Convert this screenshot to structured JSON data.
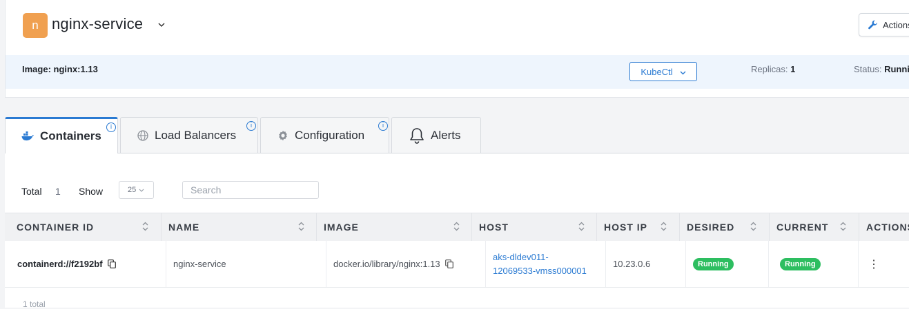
{
  "header": {
    "avatar_letter": "n",
    "service_name": "nginx-service",
    "actions_label": "Actions",
    "image_label": "Image: nginx:1.13",
    "kubectl_label": "KubeCtl",
    "replicas_label": "Replicas:",
    "replicas_value": "1",
    "status_label": "Status:",
    "status_value": "Running"
  },
  "tabs": [
    {
      "label": "Containers",
      "icon": "docker-icon",
      "active": true
    },
    {
      "label": "Load Balancers",
      "icon": "globe-icon"
    },
    {
      "label": "Configuration",
      "icon": "gear-icon"
    },
    {
      "label": "Alerts",
      "icon": "bell-icon"
    }
  ],
  "toolbar": {
    "total_label": "Total",
    "total_value": "1",
    "show_label": "Show",
    "page_size": "25",
    "search_placeholder": "Search"
  },
  "table": {
    "columns": [
      "CONTAINER ID",
      "NAME",
      "IMAGE",
      "HOST",
      "HOST IP",
      "DESIRED",
      "CURRENT",
      "ACTIONS"
    ],
    "rows": [
      {
        "container_id": "containerd://f2192bf",
        "name": "nginx-service",
        "image": "docker.io/library/nginx:1.13",
        "host_line1": "aks-dldev011-",
        "host_line2": "12069533-vmss000001",
        "host_ip": "10.23.0.6",
        "desired": "Running",
        "current": "Running",
        "actions": "⋮"
      }
    ]
  },
  "footer": {
    "total_text": "1 total"
  },
  "colors": {
    "accent": "#2a7ad2",
    "avatar": "#f0a050",
    "running": "#2dbe60"
  }
}
